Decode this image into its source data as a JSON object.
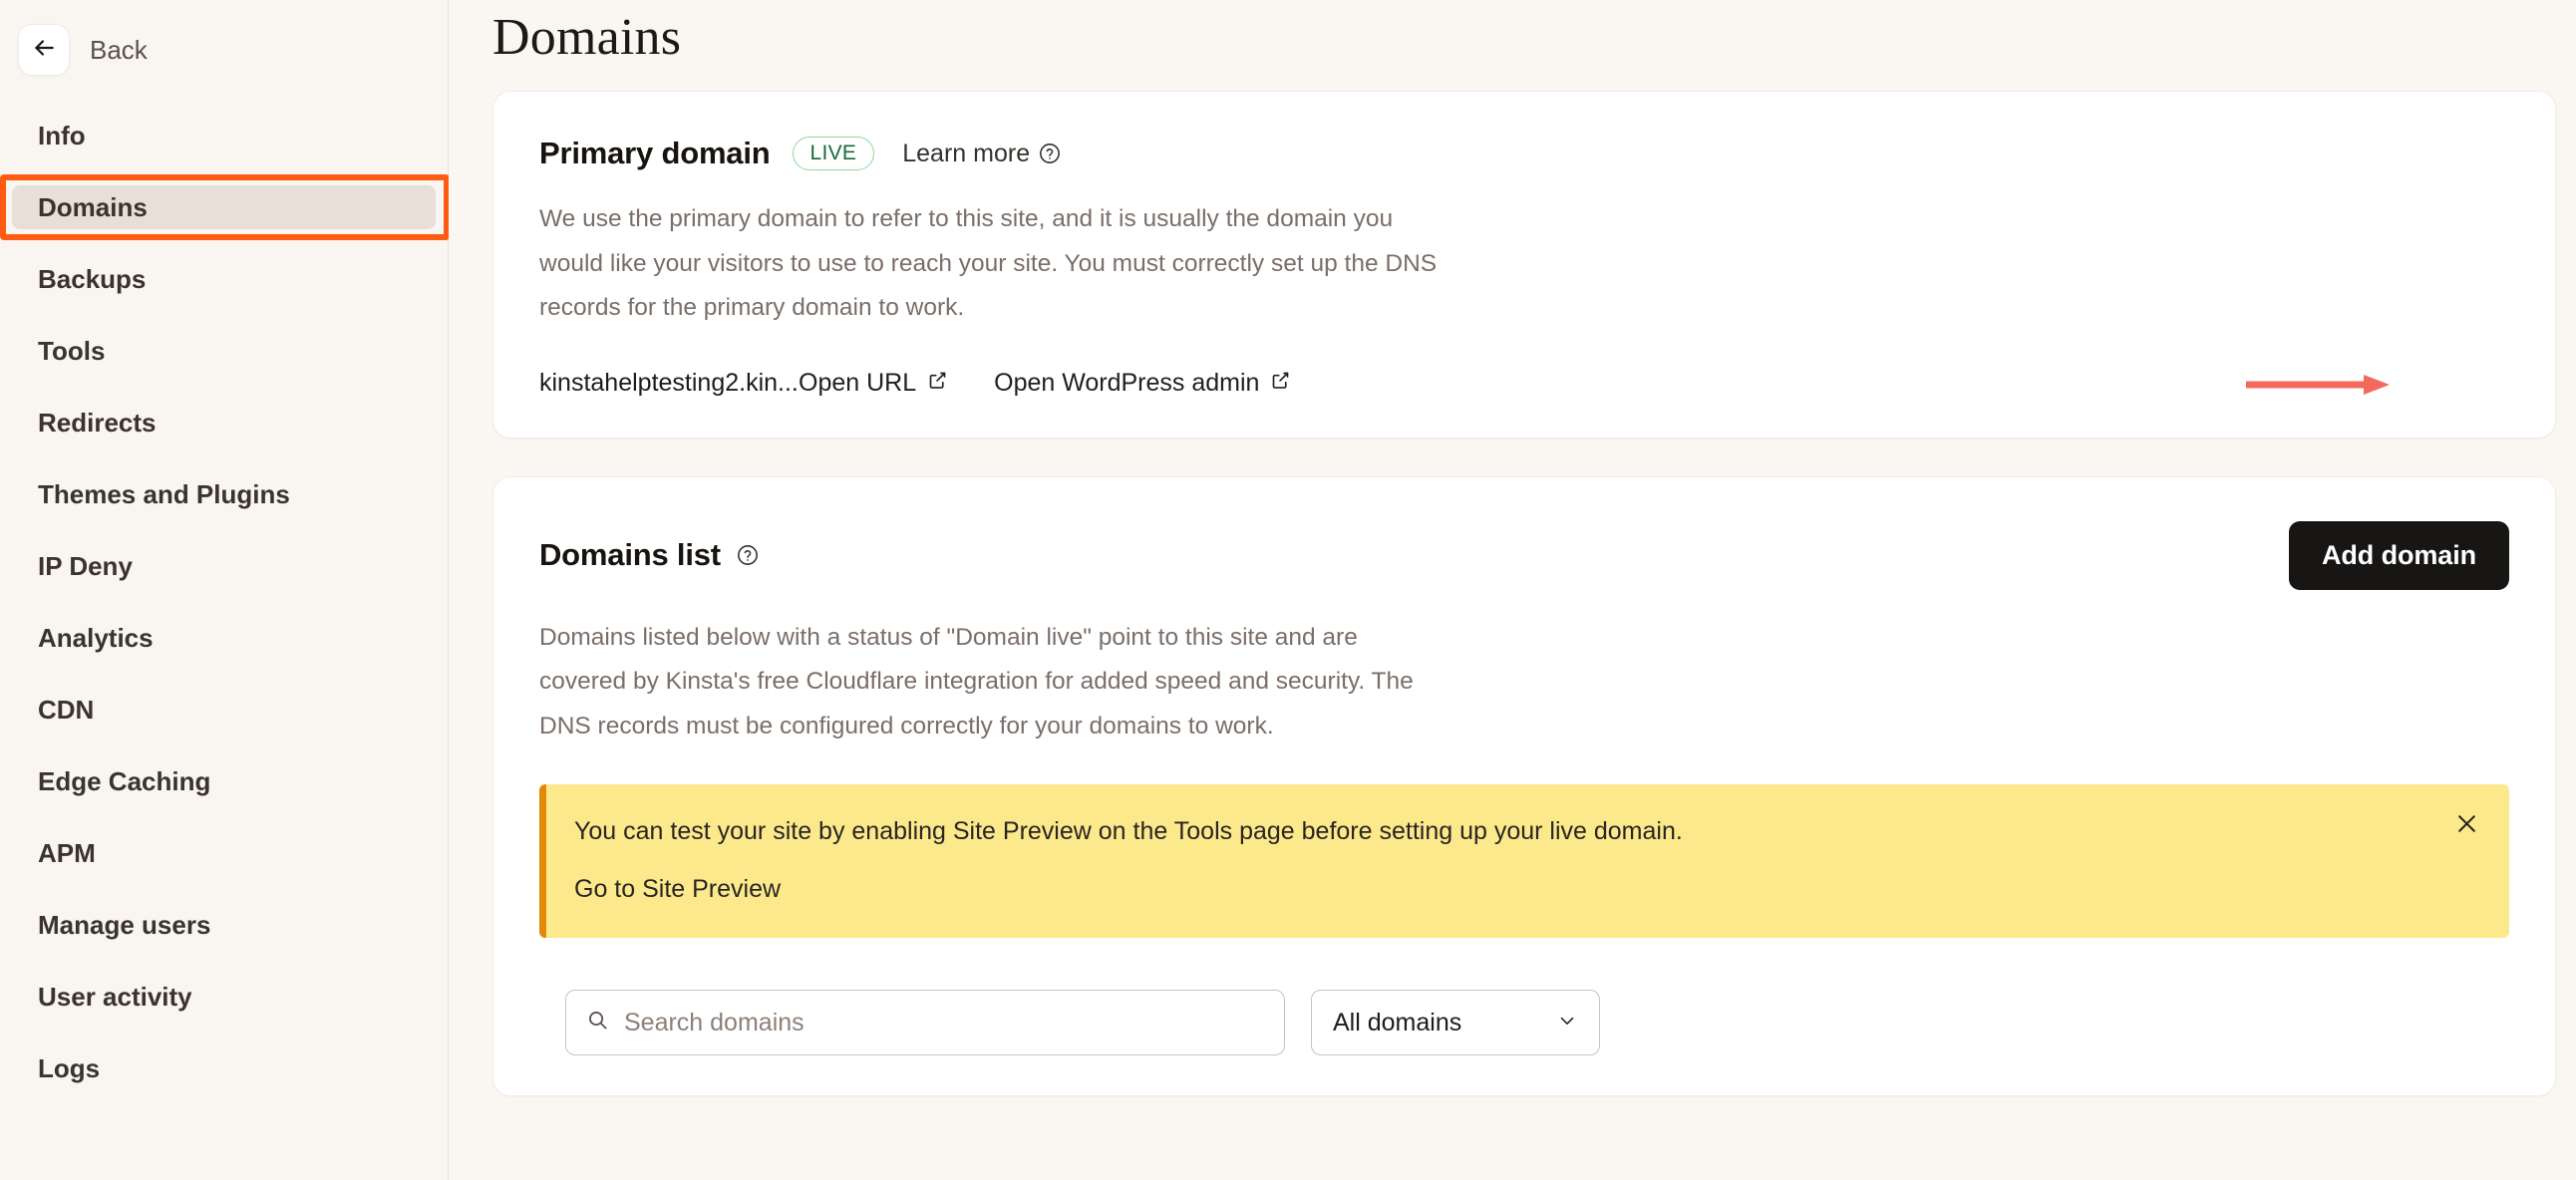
{
  "sidebar": {
    "back_label": "Back",
    "back_icon": "arrow-left-icon",
    "items": [
      {
        "label": "Info",
        "active": false
      },
      {
        "label": "Domains",
        "active": true
      },
      {
        "label": "Backups",
        "active": false
      },
      {
        "label": "Tools",
        "active": false
      },
      {
        "label": "Redirects",
        "active": false
      },
      {
        "label": "Themes and Plugins",
        "active": false
      },
      {
        "label": "IP Deny",
        "active": false
      },
      {
        "label": "Analytics",
        "active": false
      },
      {
        "label": "CDN",
        "active": false
      },
      {
        "label": "Edge Caching",
        "active": false
      },
      {
        "label": "APM",
        "active": false
      },
      {
        "label": "Manage users",
        "active": false
      },
      {
        "label": "User activity",
        "active": false
      },
      {
        "label": "Logs",
        "active": false
      }
    ]
  },
  "page": {
    "title": "Domains"
  },
  "primary_domain": {
    "title": "Primary domain",
    "status_badge": "LIVE",
    "learn_more_label": "Learn more",
    "learn_more_icon": "help-circle-icon",
    "description": "We use the primary domain to refer to this site, and it is usually the domain you would like your visitors to use to reach your site. You must correctly set up the DNS records for the primary domain to work.",
    "domain_name": "kinstahelptesting2.kin...",
    "links": [
      {
        "label": "Open URL",
        "icon": "external-link-icon"
      },
      {
        "label": "Open WordPress admin",
        "icon": "external-link-icon"
      }
    ]
  },
  "domains_list": {
    "title": "Domains list",
    "title_help_icon": "help-circle-icon",
    "add_button_label": "Add domain",
    "description": "Domains listed below with a status of \"Domain live\" point to this site and are covered by Kinsta's free Cloudflare integration for added speed and security. The DNS records must be configured correctly for your domains to work.",
    "alert": {
      "message": "You can test your site by enabling Site Preview on the Tools page before setting up your live domain.",
      "link_label": "Go to Site Preview",
      "close_icon": "close-icon"
    },
    "search": {
      "placeholder": "Search domains",
      "value": "",
      "icon": "search-icon"
    },
    "filter": {
      "selected": "All domains",
      "chevron_icon": "chevron-down-icon"
    }
  },
  "annotations": {
    "highlight_target": "Domains",
    "arrow_target": "Add domain",
    "accent_color": "#FF5B12",
    "arrow_color": "#F4695C"
  }
}
